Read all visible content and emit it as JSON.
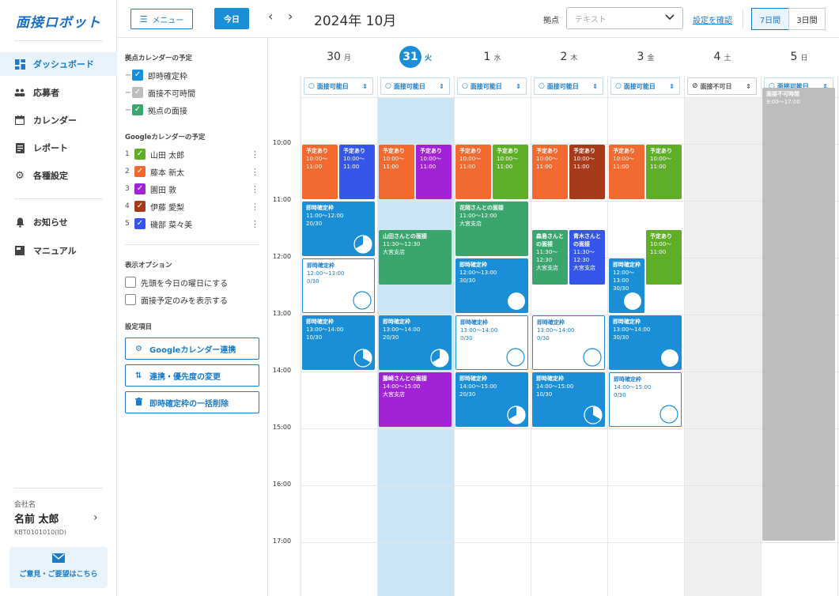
{
  "app": {
    "logo": "面接ロボット"
  },
  "nav": {
    "items": [
      {
        "label": "ダッシュボード",
        "icon": "dashboard-icon",
        "active": true
      },
      {
        "label": "応募者",
        "icon": "applicants-icon",
        "active": false
      },
      {
        "label": "カレンダー",
        "icon": "calendar-icon",
        "active": false
      },
      {
        "label": "レポート",
        "icon": "report-icon",
        "active": false
      },
      {
        "label": "各種設定",
        "icon": "gear-icon",
        "active": false
      },
      {
        "label": "お知らせ",
        "icon": "bell-icon",
        "active": false
      },
      {
        "label": "マニュアル",
        "icon": "manual-icon",
        "active": false
      }
    ],
    "company_label": "会社名",
    "user_name": "名前 太郎",
    "user_id": "KBT0101010(ID)",
    "feedback": "ご意見・ご要望はこちら"
  },
  "toolbar": {
    "menu_label": "メニュー",
    "today_label": "今日",
    "month_title": "2024年 10月",
    "location_label": "拠点",
    "location_placeholder": "テキスト",
    "settings_link": "設定を確認",
    "view_7": "7日間",
    "view_3": "3日間"
  },
  "side": {
    "loc_title": "拠点カレンダーの予定",
    "loc_items": [
      {
        "label": "即時確定枠",
        "color": "#1a8fd8"
      },
      {
        "label": "面接不可時間",
        "color": "#bdbdbd"
      },
      {
        "label": "拠点の面接",
        "color": "#3aa66e"
      }
    ],
    "google_title": "Googleカレンダーの予定",
    "google_items": [
      {
        "num": "1",
        "label": "山田 太郎",
        "color": "#5fae28"
      },
      {
        "num": "2",
        "label": "藤本 新太",
        "color": "#f26a30"
      },
      {
        "num": "3",
        "label": "園田 敦",
        "color": "#a123d6"
      },
      {
        "num": "4",
        "label": "伊藤 愛梨",
        "color": "#a83a1c"
      },
      {
        "num": "5",
        "label": "磯部 菜々美",
        "color": "#3556e8"
      }
    ],
    "options_title": "表示オプション",
    "options": [
      "先頭を今日の曜日にする",
      "面接予定のみを表示する"
    ],
    "settings_title": "設定項目",
    "buttons": [
      "Googleカレンダー連携",
      "連携・優先度の変更",
      "即時確定枠の一括削除"
    ]
  },
  "calendar": {
    "days": [
      {
        "num": "30",
        "wd": "月",
        "avail": "面接可能日",
        "today": false,
        "off": false
      },
      {
        "num": "31",
        "wd": "火",
        "avail": "面接可能日",
        "today": true,
        "off": false
      },
      {
        "num": "1",
        "wd": "水",
        "avail": "面接可能日",
        "today": false,
        "off": false
      },
      {
        "num": "2",
        "wd": "木",
        "avail": "面接可能日",
        "today": false,
        "off": false
      },
      {
        "num": "3",
        "wd": "金",
        "avail": "面接可能日",
        "today": false,
        "off": false
      },
      {
        "num": "4",
        "wd": "土",
        "avail": "面接不可日",
        "today": false,
        "off": true
      },
      {
        "num": "5",
        "wd": "日",
        "avail": "面接可能日",
        "today": false,
        "off": false
      }
    ],
    "times": [
      "10:00",
      "11:00",
      "12:00",
      "13:00",
      "14:00",
      "15:00",
      "16:00",
      "17:00"
    ],
    "colors": {
      "slot": "#1a8fd8",
      "local": "#3aa66e",
      "blocked": "#bdbdbd"
    },
    "events": [
      {
        "day": 0,
        "start": 10,
        "end": 11,
        "col": 0,
        "cols": 2,
        "type": "google",
        "color": "#f26a30",
        "title": "予定あり",
        "time": "10:00〜11:00"
      },
      {
        "day": 0,
        "start": 10,
        "end": 11,
        "col": 1,
        "cols": 2,
        "type": "google",
        "color": "#3556e8",
        "title": "予定あり",
        "time": "10:00〜11:00"
      },
      {
        "day": 0,
        "start": 11,
        "end": 12,
        "col": 0,
        "cols": 1,
        "type": "slot",
        "title": "即時確定枠",
        "time": "11:00〜12:00",
        "count": "20/30",
        "fill": 0.667
      },
      {
        "day": 0,
        "start": 12,
        "end": 13,
        "col": 0,
        "cols": 1,
        "type": "slot-empty",
        "title": "即時確定枠",
        "time": "12:00〜13:00",
        "count": "0/30",
        "fill": 0
      },
      {
        "day": 0,
        "start": 13,
        "end": 14,
        "col": 0,
        "cols": 1,
        "type": "slot",
        "title": "即時確定枠",
        "time": "13:00〜14:00",
        "count": "10/30",
        "fill": 0.333
      },
      {
        "day": 1,
        "start": 10,
        "end": 11,
        "col": 0,
        "cols": 2,
        "type": "google",
        "color": "#f26a30",
        "title": "予定あり",
        "time": "10:00〜11:00"
      },
      {
        "day": 1,
        "start": 10,
        "end": 11,
        "col": 1,
        "cols": 2,
        "type": "google",
        "color": "#a123d6",
        "title": "予定あり",
        "time": "10:00〜11:00"
      },
      {
        "day": 1,
        "start": 11.5,
        "end": 12.5,
        "col": 0,
        "cols": 1,
        "type": "local",
        "title": "山田さんとの面接",
        "time": "11:30〜12:30",
        "place": "大宮支店"
      },
      {
        "day": 1,
        "start": 13,
        "end": 14,
        "col": 0,
        "cols": 1,
        "type": "slot",
        "title": "即時確定枠",
        "time": "13:00〜14:00",
        "count": "20/30",
        "fill": 0.667
      },
      {
        "day": 1,
        "start": 14,
        "end": 15,
        "col": 0,
        "cols": 1,
        "type": "purple",
        "color": "#a123d6",
        "title": "藤崎さんとの面接",
        "time": "14:00〜15:00",
        "place": "大宮支店"
      },
      {
        "day": 2,
        "start": 10,
        "end": 11,
        "col": 0,
        "cols": 2,
        "type": "google",
        "color": "#f26a30",
        "title": "予定あり",
        "time": "10:00〜11:00"
      },
      {
        "day": 2,
        "start": 10,
        "end": 11,
        "col": 1,
        "cols": 2,
        "type": "google",
        "color": "#5fae28",
        "title": "予定あり",
        "time": "10:00〜11:00"
      },
      {
        "day": 2,
        "start": 11,
        "end": 12,
        "col": 0,
        "cols": 1,
        "type": "local",
        "title": "花岡さんとの面接",
        "time": "11:00〜12:00",
        "place": "大宮支店"
      },
      {
        "day": 2,
        "start": 12,
        "end": 13,
        "col": 0,
        "cols": 1,
        "type": "slot",
        "title": "即時確定枠",
        "time": "12:00〜13:00",
        "count": "30/30",
        "fill": 1
      },
      {
        "day": 2,
        "start": 13,
        "end": 14,
        "col": 0,
        "cols": 1,
        "type": "slot-empty",
        "title": "即時確定枠",
        "time": "13:00〜14:00",
        "count": "0/30",
        "fill": 0
      },
      {
        "day": 2,
        "start": 14,
        "end": 15,
        "col": 0,
        "cols": 1,
        "type": "slot",
        "title": "即時確定枠",
        "time": "14:00〜15:00",
        "count": "20/30",
        "fill": 0.667
      },
      {
        "day": 3,
        "start": 10,
        "end": 11,
        "col": 0,
        "cols": 2,
        "type": "google",
        "color": "#f26a30",
        "title": "予定あり",
        "time": "10:00〜11:00"
      },
      {
        "day": 3,
        "start": 10,
        "end": 11,
        "col": 1,
        "cols": 2,
        "type": "google",
        "color": "#a83a1c",
        "title": "予定あり",
        "time": "10:00〜11:00"
      },
      {
        "day": 3,
        "start": 11.5,
        "end": 12.5,
        "col": 0,
        "cols": 2,
        "type": "local",
        "title": "森島さんとの面接",
        "time": "11:30〜12:30",
        "place": "大宮支店"
      },
      {
        "day": 3,
        "start": 11.5,
        "end": 12.5,
        "col": 1,
        "cols": 2,
        "type": "google",
        "color": "#3556e8",
        "title": "青木さんとの面接",
        "time": "11:30〜12:30",
        "place": "大宮支店"
      },
      {
        "day": 3,
        "start": 13,
        "end": 14,
        "col": 0,
        "cols": 1,
        "type": "slot-empty",
        "title": "即時確定枠",
        "time": "13:00〜14:00",
        "count": "0/30",
        "fill": 0
      },
      {
        "day": 3,
        "start": 14,
        "end": 15,
        "col": 0,
        "cols": 1,
        "type": "slot",
        "title": "即時確定枠",
        "time": "14:00〜15:00",
        "count": "10/30",
        "fill": 0.333
      },
      {
        "day": 4,
        "start": 10,
        "end": 11,
        "col": 0,
        "cols": 2,
        "type": "google",
        "color": "#f26a30",
        "title": "予定あり",
        "time": "10:00〜11:00"
      },
      {
        "day": 4,
        "start": 10,
        "end": 11,
        "col": 1,
        "cols": 2,
        "type": "google",
        "color": "#5fae28",
        "title": "予定あり",
        "time": "10:00〜11:00"
      },
      {
        "day": 4,
        "start": 11.5,
        "end": 12.5,
        "col": 1,
        "cols": 2,
        "type": "google",
        "color": "#5fae28",
        "title": "予定あり",
        "time": "10:00〜11:00"
      },
      {
        "day": 4,
        "start": 12,
        "end": 13,
        "col": 0,
        "cols": 2,
        "type": "slot",
        "title": "即時確定枠",
        "time": "12:00〜13:00",
        "count": "30/30",
        "fill": 1
      },
      {
        "day": 4,
        "start": 13,
        "end": 14,
        "col": 0,
        "cols": 1,
        "type": "slot",
        "title": "即時確定枠",
        "time": "13:00〜14:00",
        "count": "30/30",
        "fill": 1
      },
      {
        "day": 4,
        "start": 14,
        "end": 15,
        "col": 0,
        "cols": 1,
        "type": "slot-empty",
        "title": "即時確定枠",
        "time": "14:00〜15:00",
        "count": "0/30",
        "fill": 0
      },
      {
        "day": 6,
        "start": 9,
        "end": 17,
        "col": 0,
        "cols": 1,
        "type": "blocked",
        "title": "面接不可時間",
        "time": "9:00〜17:00"
      }
    ]
  }
}
